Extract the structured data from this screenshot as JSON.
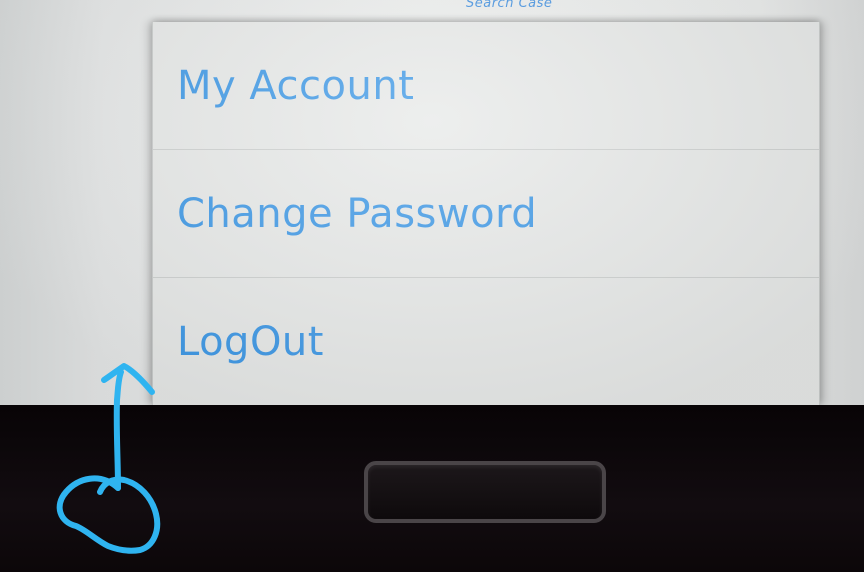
{
  "header": {
    "title": "Search Case"
  },
  "menu": {
    "items": [
      {
        "label": "My Account"
      },
      {
        "label": "Change Password"
      },
      {
        "label": "LogOut"
      }
    ]
  },
  "colors": {
    "text_accent": "#3d98e6",
    "annotation": "#2fb4f0",
    "bezel": "#0a0508"
  }
}
